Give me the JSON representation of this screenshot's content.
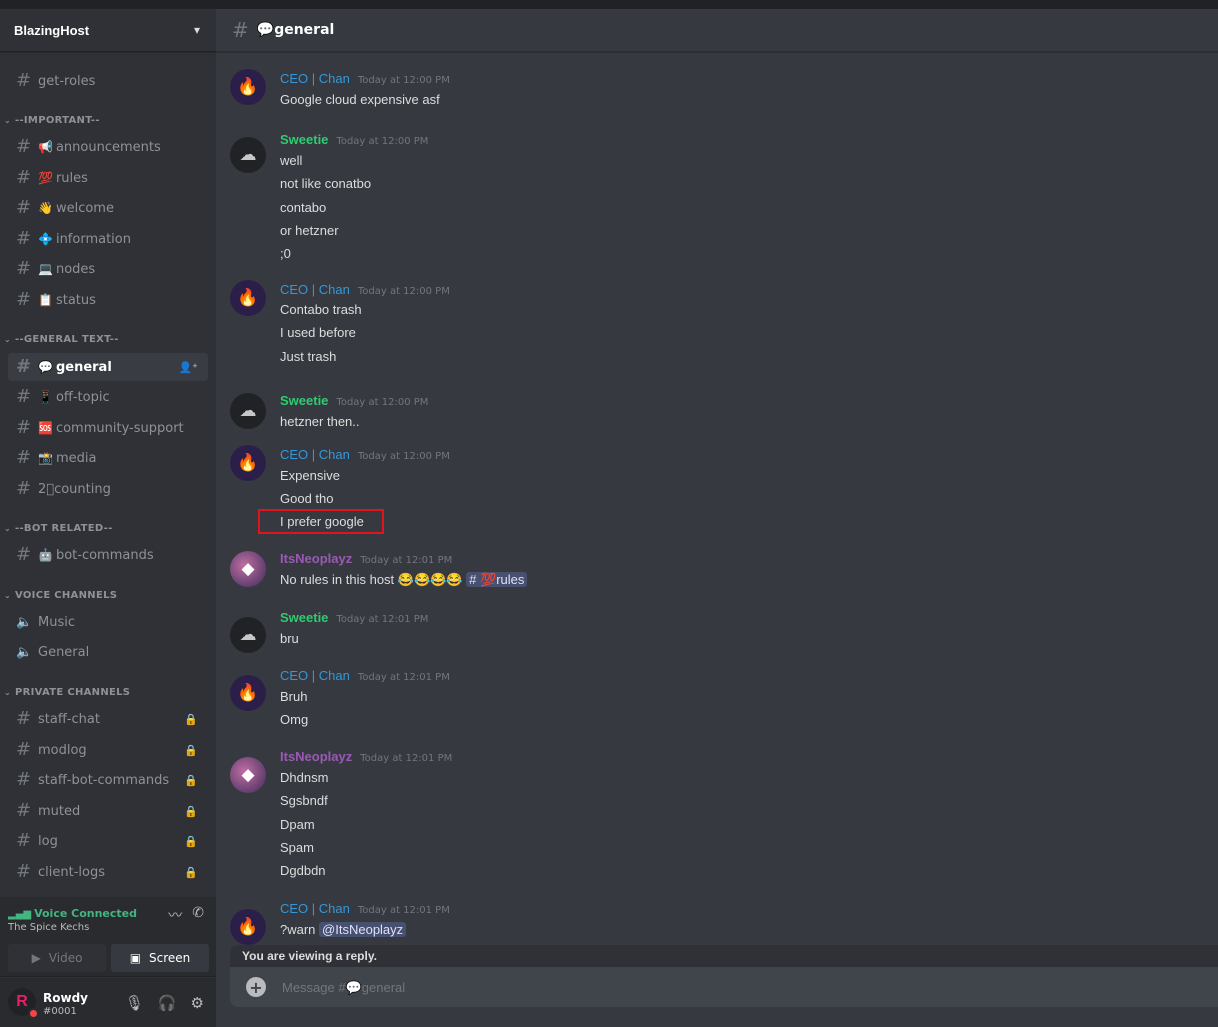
{
  "server": {
    "name": "BlazingHost",
    "dropdown_icon": "chevron-down-icon"
  },
  "channels": {
    "get_roles": {
      "emoji": "",
      "label": "get-roles"
    },
    "cat_important": "--IMPORTANT--",
    "announcements": {
      "emoji": "📢",
      "label": "announcements"
    },
    "rules": {
      "emoji": "💯",
      "label": "rules"
    },
    "welcome": {
      "emoji": "👋",
      "label": "welcome"
    },
    "information": {
      "emoji": "💠",
      "label": "information"
    },
    "nodes": {
      "emoji": "💻",
      "label": "nodes"
    },
    "status": {
      "emoji": "📋",
      "label": "status"
    },
    "cat_general_text": "--GENERAL TEXT--",
    "general": {
      "emoji": "💬",
      "label": "general"
    },
    "off_topic": {
      "emoji": "📱",
      "label": "off-topic"
    },
    "community_support": {
      "emoji": "🆘",
      "label": "community-support"
    },
    "media": {
      "emoji": "📸",
      "label": "media"
    },
    "counting": {
      "emoji": "",
      "label": "2⃣counting"
    },
    "cat_bot_related": "--BOT RELATED--",
    "bot_commands": {
      "emoji": "🤖",
      "label": "bot-commands"
    },
    "cat_voice": "VOICE CHANNELS",
    "voice_music": "Music",
    "voice_general": "General",
    "cat_private": "PRIVATE CHANNELS",
    "staff_chat": "staff-chat",
    "modlog": "modlog",
    "staff_bot_commands": "staff-bot-commands",
    "muted": "muted",
    "log": "log",
    "client_logs": "client-logs"
  },
  "voice": {
    "status": "Voice Connected",
    "location": "The Spice Kechs",
    "video_label": "Video",
    "screen_label": "Screen"
  },
  "user": {
    "name": "Rowdy",
    "tag": "#0001",
    "avatar_letter": "R"
  },
  "header": {
    "channel_title": "💬general"
  },
  "messages": [
    {
      "author": "CEO | Chan",
      "time": "Today at 12:00 PM",
      "lines": [
        "Google cloud expensive asf"
      ]
    },
    {
      "author": "Sweetie",
      "time": "Today at 12:00 PM",
      "lines": [
        "well",
        "not like conatbo",
        "contabo",
        "or hetzner",
        ";0"
      ]
    },
    {
      "author": "CEO | Chan",
      "time": "Today at 12:00 PM",
      "lines": [
        "Contabo trash",
        "I used before",
        "Just trash"
      ]
    },
    {
      "author": "Sweetie",
      "time": "Today at 12:00 PM",
      "lines": [
        "hetzner then.."
      ]
    },
    {
      "author": "CEO | Chan",
      "time": "Today at 12:00 PM",
      "lines": [
        "Expensive",
        "Good tho",
        "I prefer google"
      ]
    },
    {
      "author": "ItsNeoplayz",
      "time": "Today at 12:01 PM",
      "lines": [
        "No rules in this host"
      ],
      "emojis": "😂😂😂😂",
      "channel_mention": "# 💯rules"
    },
    {
      "author": "Sweetie",
      "time": "Today at 12:01 PM",
      "lines": [
        "bru"
      ]
    },
    {
      "author": "CEO | Chan",
      "time": "Today at 12:01 PM",
      "lines": [
        "Bruh",
        "Omg"
      ]
    },
    {
      "author": "ItsNeoplayz",
      "time": "Today at 12:01 PM",
      "lines": [
        "Dhdnsm",
        "Sgsbndf",
        "Dpam",
        "Spam",
        "Dgdbdn"
      ]
    },
    {
      "author": "CEO | Chan",
      "time": "Today at 12:01 PM",
      "lines": [
        "?warn"
      ],
      "user_mention": "@ItsNeoplayz"
    }
  ],
  "reply_bar": "You are viewing a reply.",
  "composer": {
    "placeholder": "Message #💬general"
  }
}
